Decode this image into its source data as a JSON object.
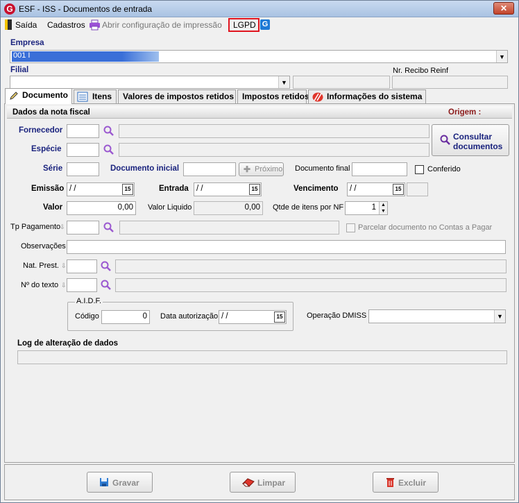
{
  "window": {
    "title": "ESF - ISS - Documentos de entrada",
    "close_glyph": "✕",
    "app_icon_letter": "G"
  },
  "menu": {
    "exit": "Saída",
    "registers": "Cadastros",
    "print_config": "Abrir configuração de impressão",
    "lgpd": "LGPD"
  },
  "header": {
    "empresa_label": "Empresa",
    "empresa_value": "001 I",
    "filial_label": "Filial",
    "filial_value": "",
    "recibo_label": "Nr. Recibo Reinf",
    "recibo_value": ""
  },
  "tabs": [
    {
      "label": "Documento",
      "active": true
    },
    {
      "label": "Itens"
    },
    {
      "label": "Valores de impostos retidos"
    },
    {
      "label": "Impostos retidos"
    },
    {
      "label": "Informações do sistema"
    }
  ],
  "section": {
    "title": "Dados da nota fiscal",
    "origem_label": "Origem :"
  },
  "form": {
    "fornecedor_label": "Fornecedor",
    "especie_label": "Espécie",
    "consultar_label_1": "Consultar",
    "consultar_label_2": "documentos",
    "serie_label": "Série",
    "doc_inicial_label": "Documento inicial",
    "proximo_label": "Próximo",
    "doc_final_label": "Documento final",
    "conferido_label": "Conferido",
    "emissao_label": "Emissão",
    "emissao_value": "/ /",
    "entrada_label": "Entrada",
    "entrada_value": "/ /",
    "vencimento_label": "Vencimento",
    "vencimento_value": "/ /",
    "valor_label": "Valor",
    "valor_value": "0,00",
    "valor_liquido_label": "Valor Liquido",
    "valor_liquido_value": "0,00",
    "qtde_label": "Qtde de itens por NF",
    "qtde_value": "1",
    "tp_pagamento_label": "Tp Pagamento",
    "parcelar_label": "Parcelar documento no Contas a Pagar",
    "observacoes_label": "Observações",
    "nat_prest_label": "Nat. Prest.",
    "n_texto_label": "Nº do texto",
    "aidf_title": "A.I.D.F.",
    "codigo_label": "Código",
    "codigo_value": "0",
    "data_autorizacao_label": "Data autorização",
    "data_autorizacao_value": "/ /",
    "operacao_dmiss_label": "Operação DMISS",
    "log_label": "Log de alteração de dados",
    "calendar_glyph": "15"
  },
  "buttons": {
    "save": "Gravar",
    "clear": "Limpar",
    "delete": "Excluir"
  },
  "colors": {
    "label_blue": "#1a237e",
    "origem_red": "#8b1a1a",
    "lgpd_highlight": "#e0141e",
    "selection_blue": "#3a6fd8"
  }
}
